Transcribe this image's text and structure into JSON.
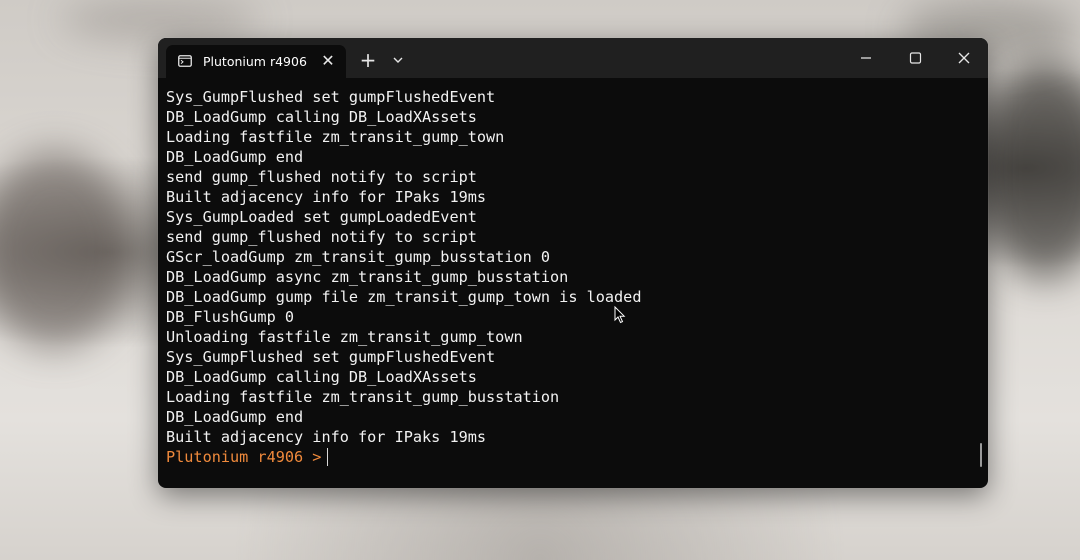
{
  "window": {
    "tab_title": "Plutonium r4906",
    "tab_close_glyph": "✕",
    "new_tab_glyph": "+",
    "dropdown_icon": "chevron-down-icon",
    "controls": [
      "minimize-icon",
      "maximize-icon",
      "close-icon"
    ]
  },
  "terminal": {
    "lines": [
      "Sys_GumpFlushed set gumpFlushedEvent",
      "DB_LoadGump calling DB_LoadXAssets",
      "Loading fastfile zm_transit_gump_town",
      "DB_LoadGump end",
      "send gump_flushed notify to script",
      "Built adjacency info for IPaks 19ms",
      "Sys_GumpLoaded set gumpLoadedEvent",
      "send gump_flushed notify to script",
      "GScr_loadGump zm_transit_gump_busstation 0",
      "DB_LoadGump async zm_transit_gump_busstation",
      "DB_LoadGump gump file zm_transit_gump_town is loaded",
      "DB_FlushGump 0",
      "Unloading fastfile zm_transit_gump_town",
      "Sys_GumpFlushed set gumpFlushedEvent",
      "DB_LoadGump calling DB_LoadXAssets",
      "Loading fastfile zm_transit_gump_busstation",
      "DB_LoadGump end",
      "Built adjacency info for IPaks 19ms"
    ],
    "prompt": "Plutonium r4906 >"
  },
  "colors": {
    "terminal_bg": "#0c0c0c",
    "titlebar_bg": "#202020",
    "text": "#f2f2f2",
    "prompt": "#f08a3c"
  }
}
